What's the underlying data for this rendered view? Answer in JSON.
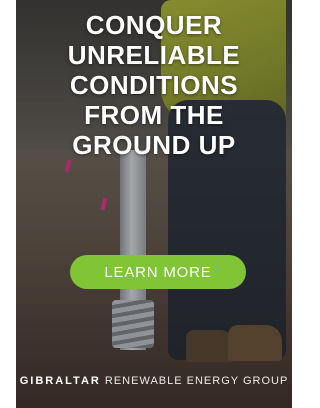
{
  "ad": {
    "headline_lines": [
      "CONQUER",
      "UNRELIABLE",
      "CONDITIONS",
      "FROM THE",
      "GROUND UP"
    ],
    "cta_label": "LEARN MORE",
    "brand_name": "GIBRALTAR",
    "brand_tagline": "RENEWABLE ENERGY GROUP"
  },
  "colors": {
    "cta_background": "#7fc535",
    "text": "#ffffff",
    "accent_marker": "#e2318a"
  }
}
